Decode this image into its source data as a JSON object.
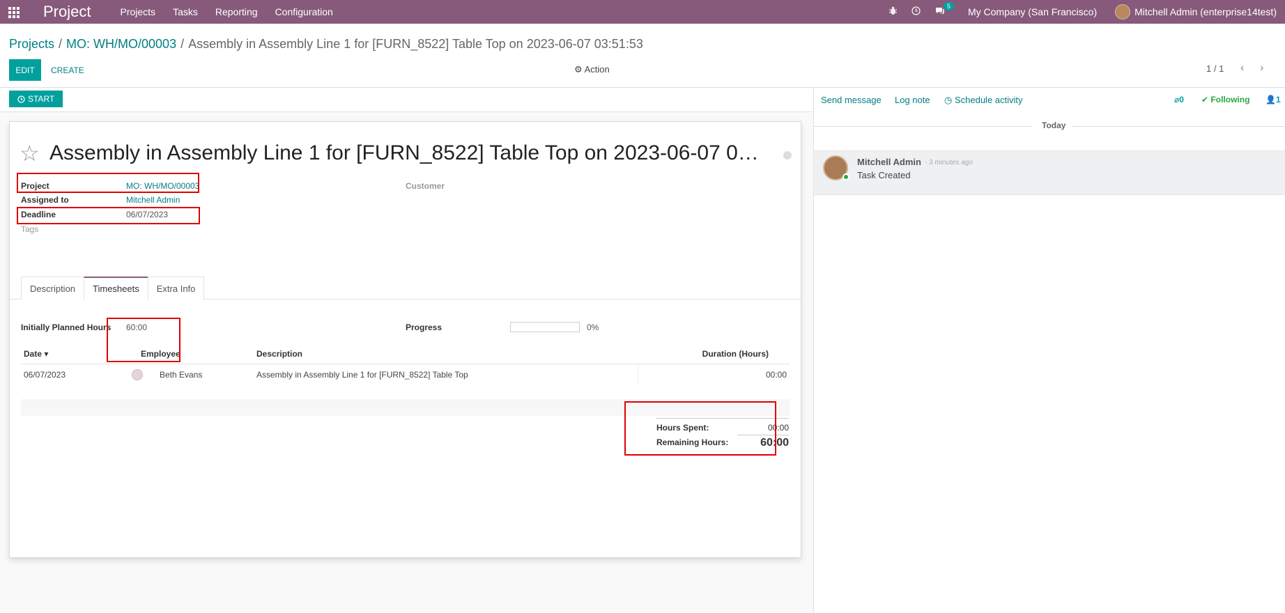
{
  "navbar": {
    "brand": "Project",
    "menu": [
      "Projects",
      "Tasks",
      "Reporting",
      "Configuration"
    ],
    "chat_count": "5",
    "company": "My Company (San Francisco)",
    "user": "Mitchell Admin (enterprise14test)",
    "accent_color": "#875a7b"
  },
  "breadcrumb": {
    "projects": "Projects",
    "mo": "MO: WH/MO/00003",
    "current": "Assembly in Assembly Line 1 for [FURN_8522] Table Top on 2023-06-07 03:51:53"
  },
  "toolbar": {
    "edit": "EDIT",
    "create": "CREATE",
    "action": "Action",
    "pager": "1 / 1"
  },
  "statusbar": {
    "start": "START"
  },
  "form": {
    "title": "Assembly in Assembly Line 1 for [FURN_8522] Table Top on 2023-06-07 0…",
    "project_label": "Project",
    "project_value": "MO: WH/MO/00003",
    "assigned_label": "Assigned to",
    "assigned_value": "Mitchell Admin",
    "deadline_label": "Deadline",
    "deadline_value": "06/07/2023",
    "tags_label": "Tags",
    "customer_label": "Customer"
  },
  "tabs": [
    "Description",
    "Timesheets",
    "Extra Info"
  ],
  "timesheets": {
    "planned_label": "Initially Planned Hours",
    "planned_value": "60:00",
    "progress_label": "Progress",
    "progress_value": "0%",
    "progress_fraction": 0,
    "columns": [
      "Date",
      "Employee",
      "Description",
      "Duration (Hours)"
    ],
    "rows": [
      {
        "date": "06/07/2023",
        "employee": "Beth Evans",
        "description": "Assembly in Assembly Line 1 for [FURN_8522] Table Top",
        "duration": "00:00"
      }
    ],
    "hours_spent_label": "Hours Spent:",
    "hours_spent_value": "00:00",
    "remaining_label": "Remaining Hours:",
    "remaining_value": "60:00"
  },
  "chatter": {
    "send_message": "Send message",
    "log_note": "Log note",
    "schedule_activity": "Schedule activity",
    "attachments": "0",
    "following": "Following",
    "followers": "1",
    "today": "Today",
    "message": {
      "author": "Mitchell Admin",
      "time": "- 3 minutes ago",
      "body": "Task Created"
    }
  }
}
